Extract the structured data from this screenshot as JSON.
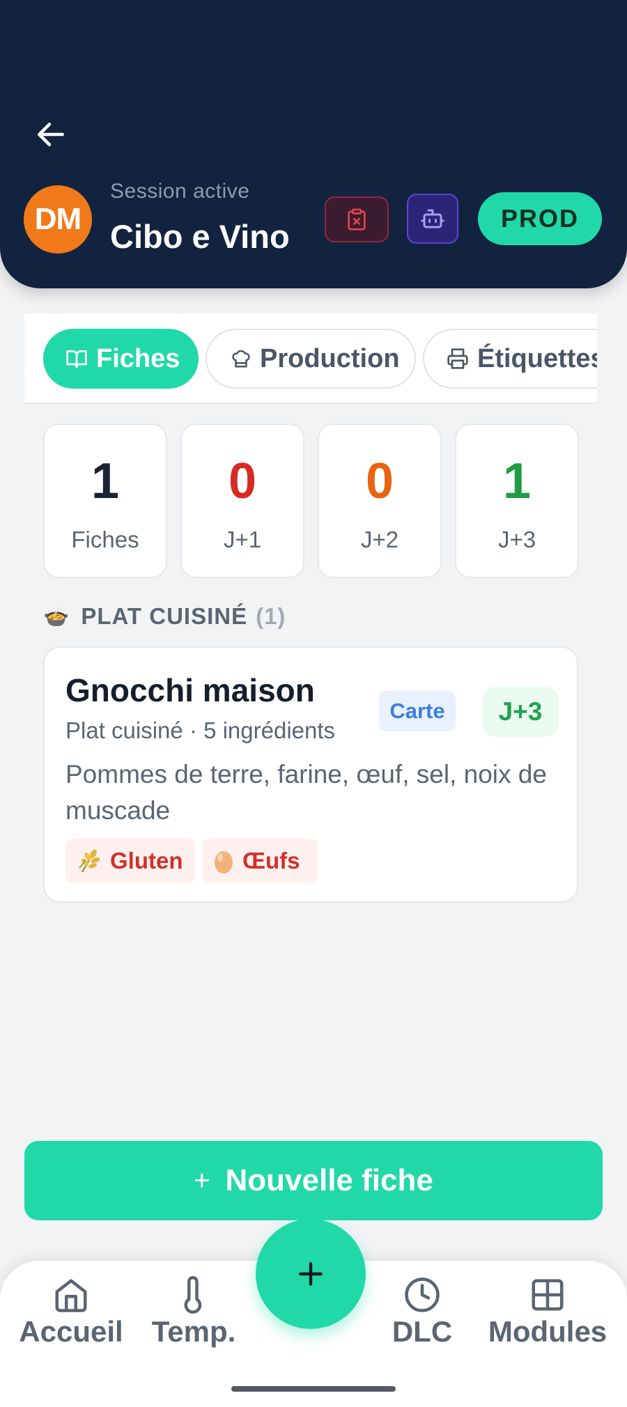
{
  "header": {
    "session_label": "Session active",
    "session_name": "Cibo e Vino",
    "avatar_initials": "DM",
    "env_badge": "PROD"
  },
  "tabs": [
    {
      "label": "Fiches",
      "icon": "book-open-icon",
      "active": true
    },
    {
      "label": "Production",
      "icon": "chef-hat-icon",
      "active": false
    },
    {
      "label": "Étiquettes",
      "icon": "printer-icon",
      "active": false
    }
  ],
  "stats": [
    {
      "value": "1",
      "label": "Fiches",
      "color": "#1b2233"
    },
    {
      "value": "0",
      "label": "J+1",
      "color": "#d62b24"
    },
    {
      "value": "0",
      "label": "J+2",
      "color": "#e8640f"
    },
    {
      "value": "1",
      "label": "J+3",
      "color": "#1f9d45"
    }
  ],
  "section": {
    "emoji": "🍲",
    "title": "PLAT CUISINÉ",
    "count": "(1)"
  },
  "recipe": {
    "title": "Gnocchi maison",
    "subtitle": "Plat cuisiné · 5 ingrédients",
    "description": "Pommes de terre, farine, œuf, sel, noix de muscade",
    "badge_menu": "Carte",
    "badge_dlc": "J+3",
    "allergens": [
      {
        "label": "Gluten",
        "icon": "wheat-icon"
      },
      {
        "label": "Œufs",
        "icon": "egg-icon"
      }
    ]
  },
  "actions": {
    "new_label": "Nouvelle fiche",
    "plus": "+"
  },
  "nav": [
    {
      "label": "Accueil",
      "icon": "home-icon"
    },
    {
      "label": "Temp.",
      "icon": "thermometer-icon"
    },
    {
      "label": "DLC",
      "icon": "clock-icon"
    },
    {
      "label": "Modules",
      "icon": "grid-icon"
    }
  ],
  "colors": {
    "accent": "#21d9a8",
    "header_bg": "#122340",
    "avatar": "#f07a1a"
  }
}
